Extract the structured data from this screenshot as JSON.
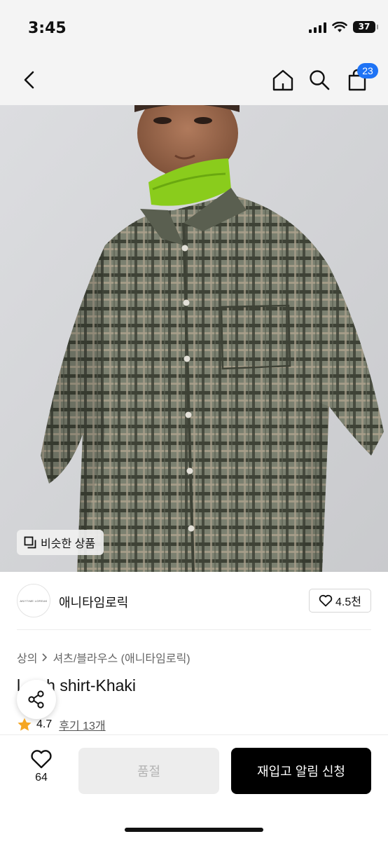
{
  "status_bar": {
    "time": "3:45",
    "battery": "37"
  },
  "header": {
    "cart_count": "23"
  },
  "hero": {
    "similar_label": "비슷한 상품"
  },
  "brand": {
    "logo_text": "ANYTIME LOREAK",
    "name": "애니타임로릭",
    "likes": "4.5천"
  },
  "product": {
    "breadcrumb": [
      "상의",
      "셔츠/블라우스 (애니타임로릭)"
    ],
    "title": "l   atch shirt-Khaki",
    "rating": "4.7",
    "reviews": "후기 13개"
  },
  "bottom": {
    "wish_count": "64",
    "soldout_label": "품절",
    "restock_label": "재입고 알림 신청"
  },
  "colors": {
    "accent": "#1e73f5",
    "star": "#f5a623",
    "shirt": "#6f7566"
  }
}
